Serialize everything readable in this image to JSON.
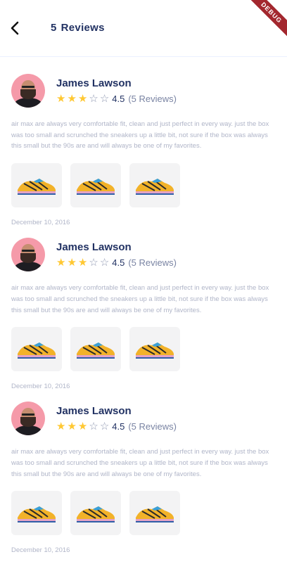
{
  "header": {
    "count": "5",
    "title": "Reviews"
  },
  "debug_banner": "DEBUG",
  "reviews": [
    {
      "name": "James Lawson",
      "rating": 4.5,
      "rating_label": "4.5",
      "reviews_count": "(5 Reviews)",
      "text": "air max are always very comfortable fit, clean and just perfect in every way. just the box was too small and scrunched the sneakers up a little bit, not sure if the box was always this small but the 90s are and will always be one of my favorites.",
      "date": "December 10, 2016"
    },
    {
      "name": "James Lawson",
      "rating": 4.5,
      "rating_label": "4.5",
      "reviews_count": "(5 Reviews)",
      "text": "air max are always very comfortable fit, clean and just perfect in every way. just the box was too small and scrunched the sneakers up a little bit, not sure if the box was always this small but the 90s are and will always be one of my favorites.",
      "date": "December 10, 2016"
    },
    {
      "name": "James Lawson",
      "rating": 4.5,
      "rating_label": "4.5",
      "reviews_count": "(5 Reviews)",
      "text": "air max are always very comfortable fit, clean and just perfect in every way. just the box was too small and scrunched the sneakers up a little bit, not sure if the box was always this small but the 90s are and will always be one of my favorites.",
      "date": "December 10, 2016"
    }
  ],
  "colors": {
    "star_filled": "#ffc833",
    "star_empty": "#9098b1",
    "title": "#223263",
    "body_text": "#b0b5c8"
  }
}
